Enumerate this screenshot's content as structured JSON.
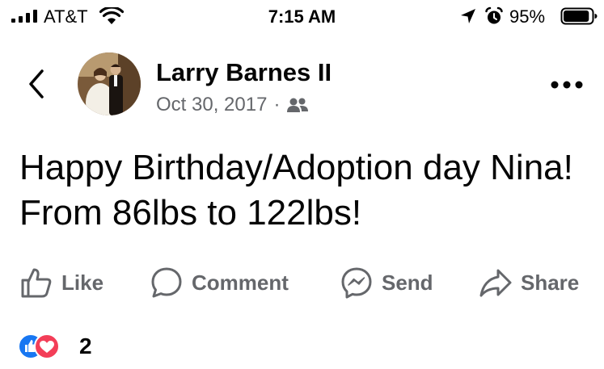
{
  "status_bar": {
    "carrier": "AT&T",
    "time": "7:15 AM",
    "battery_percent": "95%",
    "battery_level": 0.95,
    "icons": [
      "signal-icon",
      "wifi-icon",
      "location-arrow-icon",
      "alarm-icon",
      "battery-icon"
    ]
  },
  "header": {
    "back_icon": "chevron-left-icon",
    "author_name": "Larry Barnes II",
    "date": "Oct 30, 2017",
    "separator": "·",
    "audience_icon": "friends-icon",
    "more_icon": "more-horizontal-icon"
  },
  "post": {
    "text": "Happy Birthday/Adoption day Nina! From 86lbs to 122lbs!"
  },
  "actions": {
    "like": "Like",
    "comment": "Comment",
    "send": "Send",
    "share": "Share"
  },
  "reactions": {
    "types": [
      "like-reaction-icon",
      "love-reaction-icon"
    ],
    "count": "2"
  },
  "colors": {
    "text_primary": "#050505",
    "text_secondary": "#65676b",
    "like_blue": "#1877f2",
    "love_red": "#f33e58"
  }
}
